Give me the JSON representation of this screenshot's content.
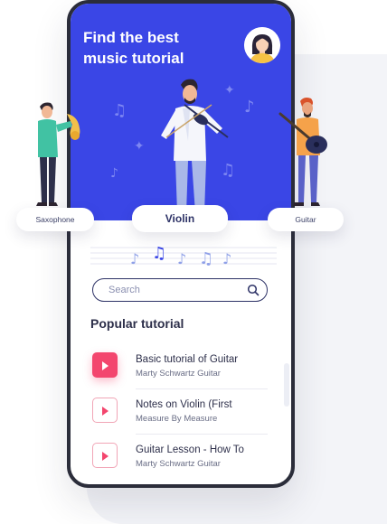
{
  "hero": {
    "title_line1": "Find the best",
    "title_line2": "music tutorial",
    "background": "#3a46e6",
    "avatar_icon": "user-avatar-woman"
  },
  "instruments": {
    "left": "Saxophone",
    "center": "Violin",
    "right": "Guitar"
  },
  "search": {
    "placeholder": "Search",
    "icon": "search-icon"
  },
  "section": {
    "title": "Popular tutorial"
  },
  "tutorials": [
    {
      "title": "Basic tutorial of Guitar",
      "subtitle": "Marty Schwartz Guitar",
      "active": true
    },
    {
      "title": "Notes on Violin (First",
      "subtitle": "Measure By Measure",
      "active": false
    },
    {
      "title": "Guitar Lesson - How To",
      "subtitle": "Marty Schwartz Guitar",
      "active": false
    }
  ],
  "colors": {
    "accent": "#3a46e6",
    "play": "#f3466e",
    "text_dark": "#2d2f4a"
  }
}
